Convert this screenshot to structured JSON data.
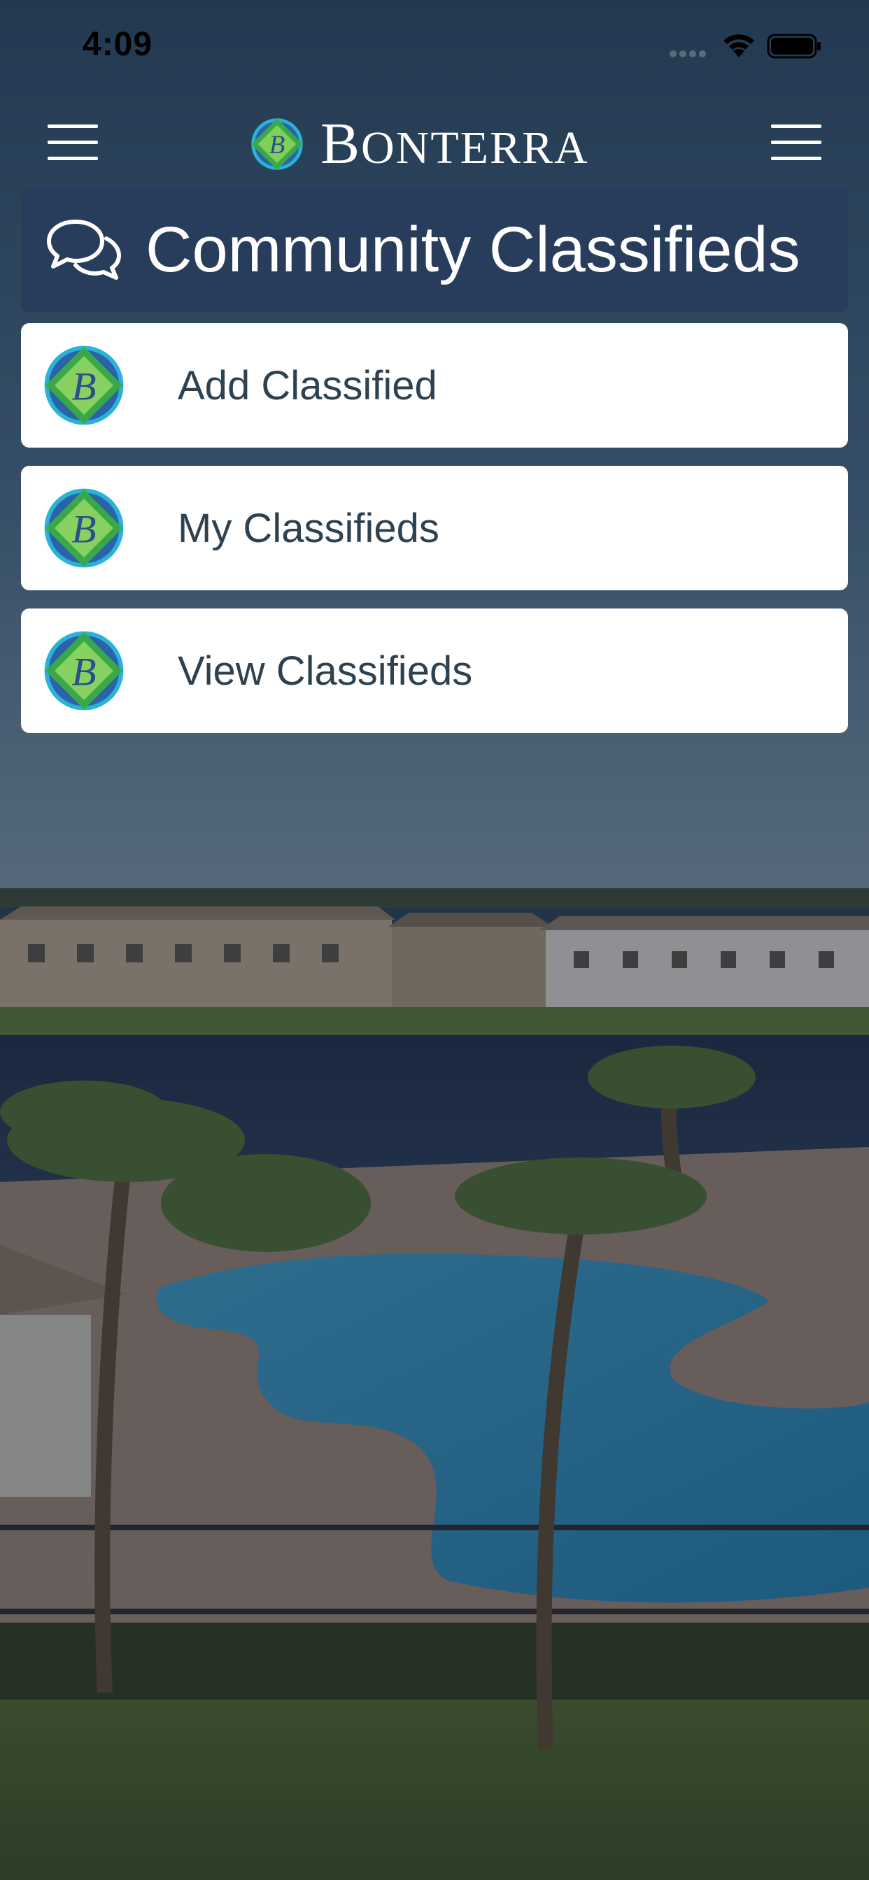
{
  "status_bar": {
    "time": "4:09"
  },
  "header": {
    "brand_first_letter": "B",
    "brand_rest": "ONTERRA",
    "left_menu_icon": "hamburger-menu-icon",
    "right_menu_icon": "hamburger-menu-icon",
    "logo_icon": "bonterra-logo-icon"
  },
  "page": {
    "title": "Community Classifieds",
    "title_icon": "chat-bubbles-icon"
  },
  "menu": [
    {
      "label": "Add Classified",
      "icon": "bonterra-logo-icon"
    },
    {
      "label": "My Classifieds",
      "icon": "bonterra-logo-icon"
    },
    {
      "label": "View Classifieds",
      "icon": "bonterra-logo-icon"
    }
  ],
  "colors": {
    "banner": "#283c5c",
    "card": "#ffffff",
    "card_text": "#2e4150",
    "logo_green": "#3aa849",
    "logo_blue": "#2a63a8"
  }
}
